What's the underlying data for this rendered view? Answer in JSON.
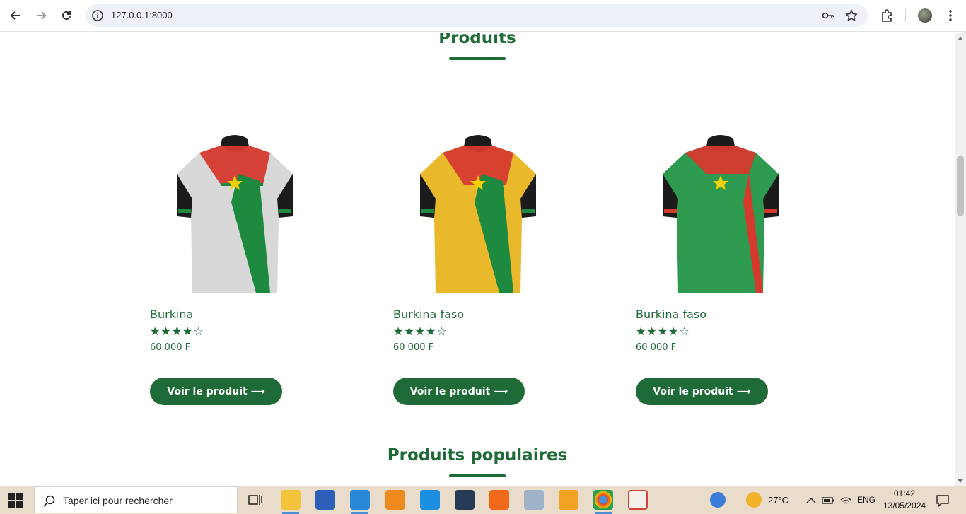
{
  "browser": {
    "url": "127.0.0.1:8000",
    "back_icon": "arrow-left-icon",
    "forward_icon": "arrow-right-icon",
    "reload_icon": "reload-icon"
  },
  "page": {
    "section_title": "Produits",
    "products": [
      {
        "name": "Burkina",
        "stars": "★★★★☆",
        "rating": 4,
        "rating_max": 5,
        "price": "60 000 F",
        "button": "Voir le produit ⟶",
        "jersey_base": "#d8d8d8"
      },
      {
        "name": "Burkina faso",
        "stars": "★★★★☆",
        "rating": 4,
        "rating_max": 5,
        "price": "60 000 F",
        "button": "Voir le produit ⟶",
        "jersey_base": "#e9b92b"
      },
      {
        "name": "Burkina faso",
        "stars": "★★★★☆",
        "rating": 4,
        "rating_max": 5,
        "price": "60 000 F",
        "button": "Voir le produit ⟶",
        "jersey_base": "#2e9a4f"
      }
    ],
    "popular_title": "Produits populaires"
  },
  "taskbar": {
    "search_placeholder": "Taper ici pour rechercher",
    "weather": "27°C",
    "language": "ENG",
    "time": "01:42",
    "date": "13/05/2024"
  },
  "colors": {
    "brand_green": "#1f6b37",
    "taskbar": "#e9dccb"
  }
}
